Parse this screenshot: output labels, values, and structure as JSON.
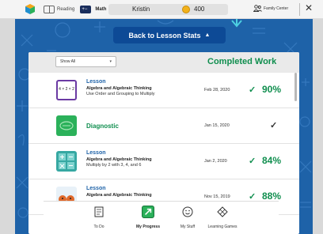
{
  "topbar": {
    "reading_label": "Reading",
    "math_label": "Math",
    "user_name": "Kristin",
    "coins": "400",
    "family_center": "Family Center",
    "close": "✕"
  },
  "panel": {
    "back_button": "Back to Lesson Stats",
    "back_caret": "▲"
  },
  "card": {
    "filter_value": "Show All",
    "filter_caret": "▾",
    "heading": "Completed Work",
    "rows": [
      {
        "type": "Lesson",
        "subject": "Algebra and Algebraic Thinking",
        "desc": "Use Order and Grouping to Multiply",
        "date": "Feb 28, 2020",
        "check": "✓",
        "score": "90%",
        "thumb_text": "4 × 2 × 2"
      },
      {
        "type": "Diagnostic",
        "date": "Jan 15, 2020",
        "check": "✓"
      },
      {
        "type": "Lesson",
        "subject": "Algebra and Algebraic Thinking",
        "desc": "Multiply by 2 with 3, 4, and 6",
        "date": "Jan 2, 2020",
        "check": "✓",
        "score": "84%"
      },
      {
        "type": "Lesson",
        "subject": "Algebra and Algebraic Thinking",
        "date": "Nov 15, 2019",
        "check": "✓",
        "score": "88%"
      }
    ]
  },
  "nav": {
    "items": [
      {
        "label": "To Do",
        "icon": "todo-icon"
      },
      {
        "label": "My Progress",
        "icon": "progress-icon"
      },
      {
        "label": "My Stuff",
        "icon": "smiley-icon"
      },
      {
        "label": "Learning Games",
        "icon": "games-icon"
      }
    ]
  },
  "colors": {
    "brand_blue": "#1e62a8",
    "success_green": "#0f8e4e",
    "button_blue": "#0d4a96"
  }
}
